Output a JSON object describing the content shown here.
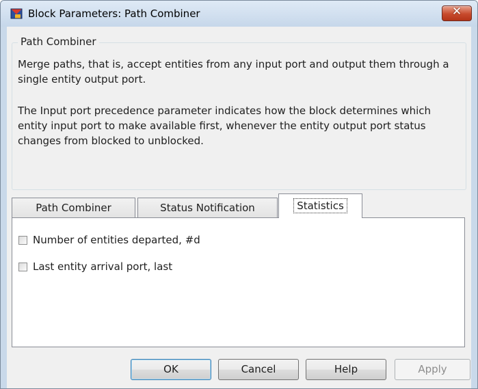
{
  "window": {
    "title": "Block Parameters: Path Combiner",
    "close_symbol": "✕"
  },
  "group": {
    "title": "Path Combiner",
    "paragraph1": "Merge paths, that is, accept entities from any input port and output them through a single entity output port.",
    "paragraph2": "The Input port precedence parameter indicates how the block determines which entity input port to make available first, whenever the entity output port status changes from blocked to unblocked."
  },
  "tabs": [
    {
      "label": "Path Combiner",
      "active": false
    },
    {
      "label": "Status Notification",
      "active": false
    },
    {
      "label": "Statistics",
      "active": true
    }
  ],
  "statistics": {
    "checkboxes": [
      {
        "label": "Number of entities departed, #d",
        "checked": false
      },
      {
        "label": "Last entity arrival port, last",
        "checked": false
      }
    ]
  },
  "buttons": {
    "ok": "OK",
    "cancel": "Cancel",
    "help": "Help",
    "apply": "Apply"
  },
  "colors": {
    "frame": "#c9d9ea",
    "close_button": "#c74a2c",
    "default_button_border": "#3c7fb1"
  },
  "icons": {
    "app": "simulink-block-icon",
    "close": "close-icon"
  }
}
